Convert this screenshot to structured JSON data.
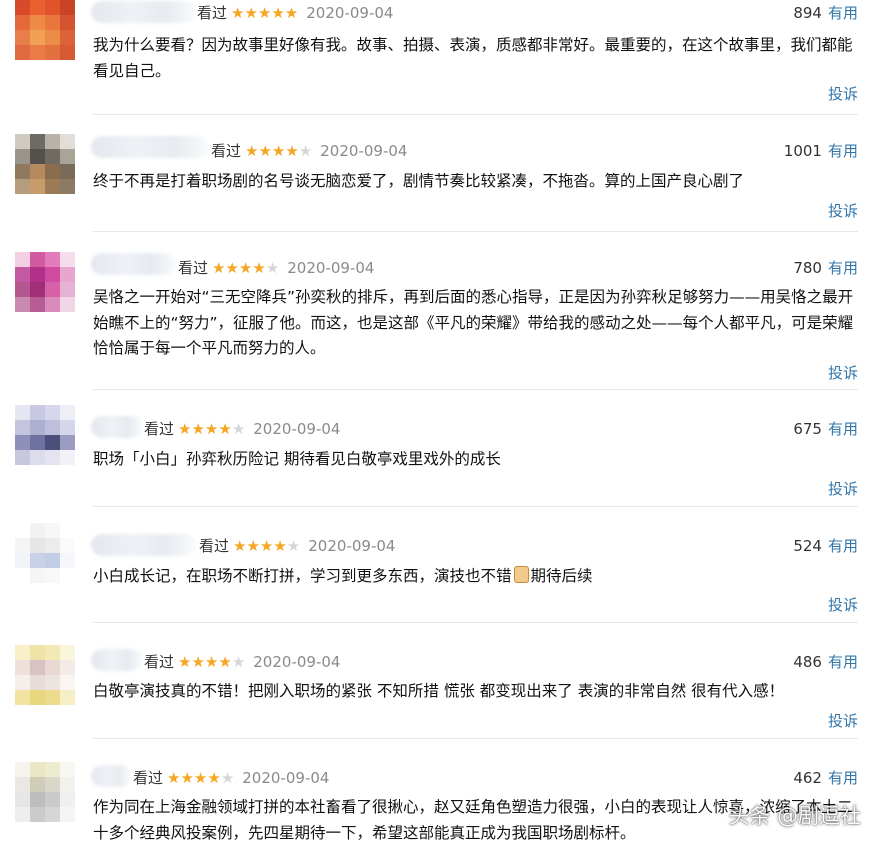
{
  "colors": {
    "star_on": "#f5a623",
    "star_off": "#d6d6d6",
    "link": "#3377aa",
    "date": "#8a8a8a"
  },
  "reviews": [
    {
      "watched": "看过",
      "stars": 5,
      "date": "2020-09-04",
      "votes": "894",
      "useful": "有用",
      "content": "我为什么要看？因为故事里好像有我。故事、拍摄、表演，质感都非常好。最重要的，在这个故事里，我们都能看见自己。",
      "report": "投诉"
    },
    {
      "watched": "看过",
      "stars": 4,
      "date": "2020-09-04",
      "votes": "1001",
      "useful": "有用",
      "content": "终于不再是打着职场剧的名号谈无脑恋爱了，剧情节奏比较紧凑，不拖沓。算的上国产良心剧了",
      "report": "投诉"
    },
    {
      "watched": "看过",
      "stars": 4,
      "date": "2020-09-04",
      "votes": "780",
      "useful": "有用",
      "content": "吴恪之一开始对“三无空降兵”孙奕秋的排斥，再到后面的悉心指导，正是因为孙弈秋足够努力——用吴恪之最开始瞧不上的“努力”，征服了他。而这，也是这部《平凡的荣耀》带给我的感动之处——每个人都平凡，可是荣耀恰恰属于每一个平凡而努力的人。",
      "report": "投诉"
    },
    {
      "watched": "看过",
      "stars": 4,
      "date": "2020-09-04",
      "votes": "675",
      "useful": "有用",
      "content": "职场「小白」孙弈秋历险记 期待看见白敬亭戏里戏外的成长",
      "report": "投诉"
    },
    {
      "watched": "看过",
      "stars": 4,
      "date": "2020-09-04",
      "votes": "524",
      "useful": "有用",
      "content_before": "小白成长记，在职场不断打拼，学习到更多东西，演技也不错",
      "content_icon": "thumbs-up-icon",
      "content_after": "期待后续",
      "report": "投诉"
    },
    {
      "watched": "看过",
      "stars": 4,
      "date": "2020-09-04",
      "votes": "486",
      "useful": "有用",
      "content": "白敬亭演技真的不错！把刚入职场的紧张 不知所措 慌张 都变现出来了 表演的非常自然 很有代入感！",
      "report": "投诉"
    },
    {
      "watched": "看过",
      "stars": 4,
      "date": "2020-09-04",
      "votes": "462",
      "useful": "有用",
      "content": "作为同在上海金融领域打拼的本社畜看了很揪心，赵又廷角色塑造力很强，小白的表现让人惊喜，浓缩了本土二十多个经典风投案例，先四星期待一下，希望这部能真正成为我国职场剧标杆。",
      "report": "投诉"
    }
  ],
  "watermark": "头条 @剧逗社"
}
